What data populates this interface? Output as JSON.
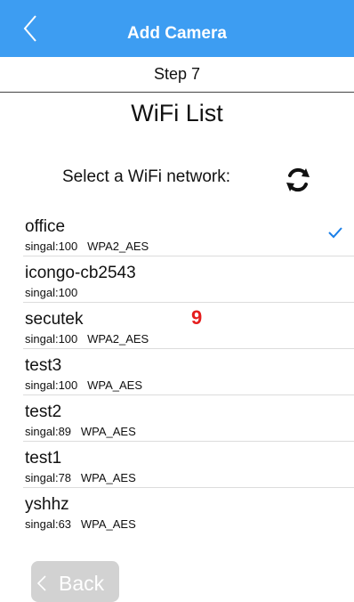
{
  "header": {
    "title": "Add Camera",
    "back_icon": "chevron-left-icon"
  },
  "step": {
    "label": "Step 7"
  },
  "page": {
    "heading": "WiFi List",
    "select_label": "Select a WiFi network:",
    "refresh_icon": "refresh-icon"
  },
  "wifi_list": [
    {
      "name": "office",
      "meta": "singal:100   WPA2_AES",
      "selected": true
    },
    {
      "name": "icongo-cb2543",
      "meta": "singal:100",
      "selected": false
    },
    {
      "name": "secutek",
      "meta": "singal:100   WPA2_AES",
      "selected": false
    },
    {
      "name": "test3",
      "meta": "singal:100   WPA_AES",
      "selected": false
    },
    {
      "name": "test2",
      "meta": "singal:89   WPA_AES",
      "selected": false
    },
    {
      "name": "test1",
      "meta": "singal:78   WPA_AES",
      "selected": false
    },
    {
      "name": "yshhz",
      "meta": "singal:63   WPA_AES",
      "selected": false
    }
  ],
  "overlay_badge": "9",
  "footer": {
    "back_label": "Back"
  },
  "colors": {
    "accent": "#3d9df2",
    "checkmark": "#1a7fe8",
    "badge": "#e51d1d",
    "back_button_bg": "#d2d2d2"
  }
}
